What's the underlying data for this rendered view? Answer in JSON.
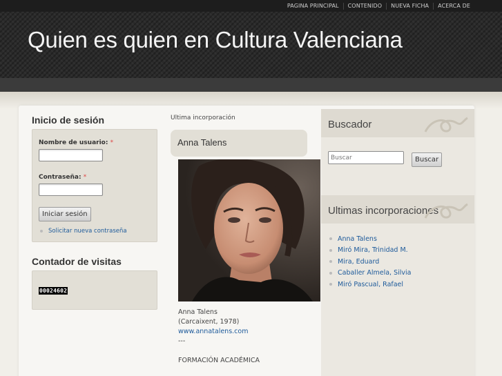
{
  "topnav": {
    "items": [
      "PAGINA PRINCIPAL",
      "CONTENIDO",
      "NUEVA FICHA",
      "ACERCA DE"
    ]
  },
  "header": {
    "site_title": "Quien es quien en Cultura Valenciana"
  },
  "login": {
    "title": "Inicio de sesión",
    "username_label": "Nombre de usuario:",
    "password_label": "Contraseña:",
    "required_mark": "*",
    "username_value": "",
    "password_value": "",
    "submit_label": "Iniciar sesión",
    "reset_link": "Solicitar nueva contraseña"
  },
  "counter": {
    "title": "Contador de visitas",
    "value": "00024602"
  },
  "center": {
    "kicker": "Ultima incorporación",
    "article_title": "Anna Talens",
    "body": {
      "line1": "Anna Talens",
      "line2": "(Carcaixent, 1978)",
      "link": "www.annatalens.com",
      "separator": "---",
      "section": "FORMACIÓN ACADÉMICA"
    }
  },
  "search": {
    "title": "Buscador",
    "placeholder": "Buscar",
    "button_label": "Buscar"
  },
  "recent": {
    "title": "Ultimas incorporaciones",
    "items": [
      "Anna Talens",
      "Miró Mira, Trinidad M.",
      "Mira, Eduard",
      "Caballer Almela, Silvia",
      "Miró Pascual, Rafael"
    ]
  },
  "colors": {
    "link": "#1d5a9a",
    "header_bg": "#2a2a2a",
    "box_bg": "#e2dfd6"
  }
}
